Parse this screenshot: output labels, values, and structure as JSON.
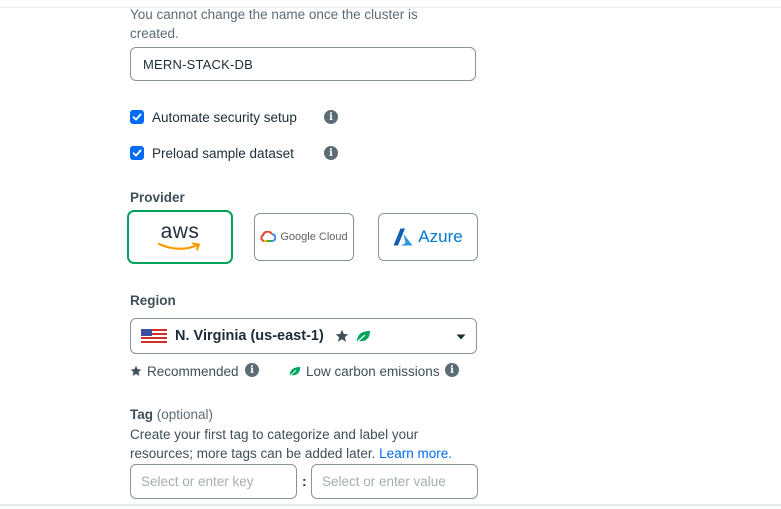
{
  "cluster_name": {
    "helptext": "You cannot change the name once the cluster is created.",
    "value": "MERN-STACK-DB"
  },
  "options": [
    {
      "label": "Automate security setup",
      "checked": true
    },
    {
      "label": "Preload sample dataset",
      "checked": true
    }
  ],
  "provider": {
    "label": "Provider",
    "items": [
      {
        "name": "aws",
        "selected": true
      },
      {
        "name": "Google Cloud",
        "selected": false
      },
      {
        "name": "Azure",
        "selected": false
      }
    ]
  },
  "region": {
    "label": "Region",
    "value": "N. Virginia (us-east-1)",
    "legend": {
      "recommended": "Recommended",
      "low_carbon": "Low carbon emissions"
    }
  },
  "tag": {
    "label": "Tag",
    "optional": "(optional)",
    "description": "Create your first tag to categorize and label your resources; more tags can be added later.",
    "link": "Learn more.",
    "key_placeholder": "Select or enter key",
    "separator": ":",
    "value_placeholder": "Select or enter value"
  },
  "colors": {
    "accent_blue": "#016bf8",
    "selected_green": "#00a35c",
    "leaf_green": "#00a35c",
    "border_gray": "#889397"
  },
  "icons": [
    "check-icon",
    "info-icon",
    "star-icon",
    "leaf-icon",
    "caret-down-icon",
    "us-flag-icon",
    "aws-logo",
    "google-cloud-logo",
    "azure-logo"
  ]
}
